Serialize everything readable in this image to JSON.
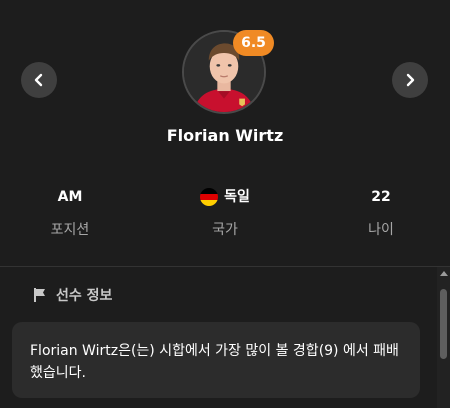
{
  "player": {
    "name": "Florian Wirtz",
    "rating": "6.5"
  },
  "stats": [
    {
      "value": "AM",
      "label": "포지션"
    },
    {
      "value": "독일",
      "label": "국가",
      "flag": "germany-flag"
    },
    {
      "value": "22",
      "label": "나이"
    }
  ],
  "section": {
    "title": "선수 정보",
    "icon": "flag-icon"
  },
  "info": {
    "text": "Florian Wirtz은(는) 시합에서 가장 많이 볼 경합(9) 에서 패배했습니다."
  },
  "colors": {
    "background": "#1d1d1d",
    "card": "#2c2c2c",
    "rating_badge": "#f08a24",
    "muted_text": "#a7a7a7"
  }
}
